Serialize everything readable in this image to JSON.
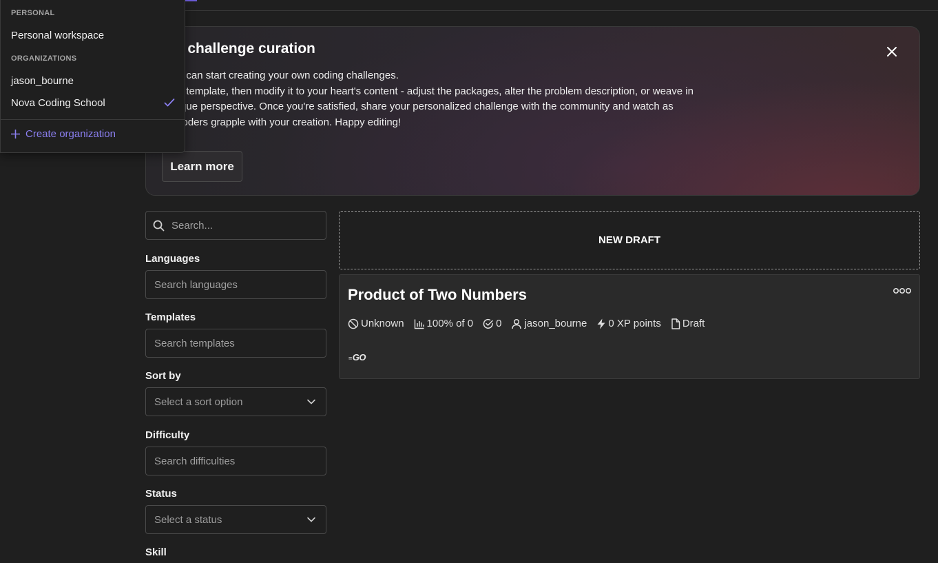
{
  "banner": {
    "title": "de challenge curation",
    "lines": [
      "you can start creating your own coding challenges.",
      "ct a template, then modify it to your heart's content - adjust the packages, alter the problem description, or weave in",
      "unique perspective. Once you're satisfied, share your personalized challenge with the community and watch as",
      "w coders grapple with your creation. Happy editing!"
    ],
    "learn_more_label": "Learn more"
  },
  "filters": {
    "search_placeholder": "Search...",
    "languages": {
      "label": "Languages",
      "placeholder": "Search languages"
    },
    "templates": {
      "label": "Templates",
      "placeholder": "Search templates"
    },
    "sort_by": {
      "label": "Sort by",
      "selected": "Select a sort option"
    },
    "difficulty": {
      "label": "Difficulty",
      "placeholder": "Search difficulties"
    },
    "status": {
      "label": "Status",
      "selected": "Select a status"
    },
    "skill": {
      "label": "Skill"
    }
  },
  "drafts": {
    "new_draft_label": "NEW DRAFT",
    "card": {
      "title": "Product of Two Numbers",
      "difficulty": "Unknown",
      "success_rate": "100% of 0",
      "completions": "0",
      "author": "jason_bourne",
      "xp": "0 XP points",
      "status": "Draft",
      "language_logo": "GO"
    }
  },
  "workspace_menu": {
    "personal_heading": "PERSONAL",
    "personal_item": "Personal workspace",
    "organizations_heading": "ORGANIZATIONS",
    "organizations": [
      "jason_bourne",
      "Nova Coding School"
    ],
    "selected": "Nova Coding School",
    "create_label": "Create organization"
  },
  "colors": {
    "background": "#1f1f1f",
    "accent": "#8b7ff0",
    "card": "#2a2a2a"
  }
}
